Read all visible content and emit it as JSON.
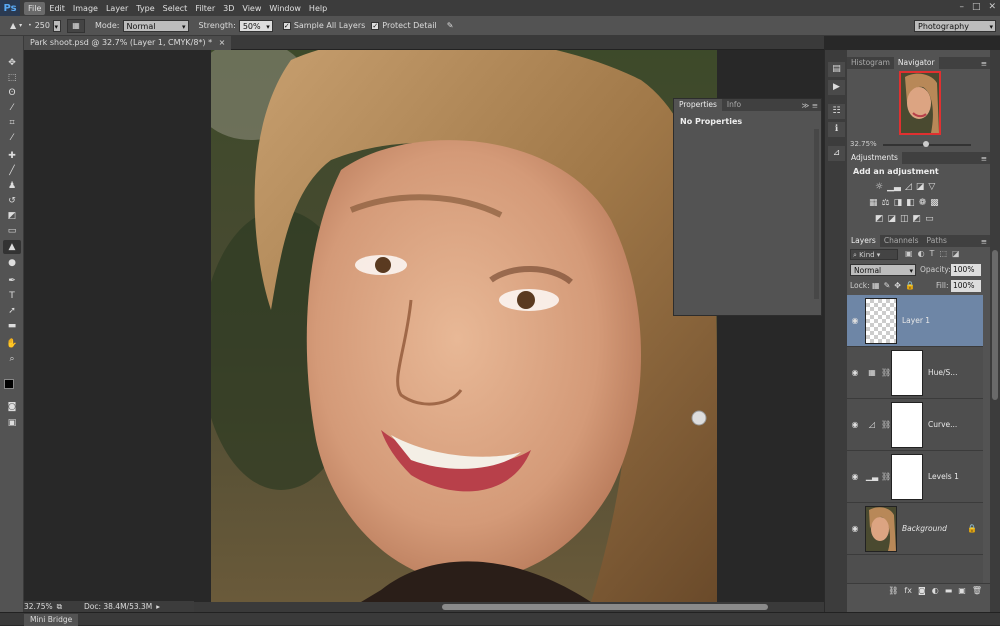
{
  "menubar": {
    "logo": "Ps",
    "items": [
      "File",
      "Edit",
      "Image",
      "Layer",
      "Type",
      "Select",
      "Filter",
      "3D",
      "View",
      "Window",
      "Help"
    ],
    "active": "File",
    "window_buttons": [
      "–",
      "□",
      "✕"
    ]
  },
  "options": {
    "brush_size": "250",
    "mode_label": "Mode:",
    "mode_value": "Normal",
    "strength_label": "Strength:",
    "strength_value": "50%",
    "sample_all_layers": "Sample All Layers",
    "protect_detail": "Protect Detail",
    "workspace": "Photography"
  },
  "document": {
    "tab_title": "Park shoot.psd @ 32.7% (Layer 1, CMYK/8*) *",
    "tab_close": "×",
    "zoom": "32.75%",
    "doc_info": "Doc: 38.4M/53.3M"
  },
  "minibridge": {
    "label": "Mini Bridge"
  },
  "properties_panel": {
    "tabs": [
      "Properties",
      "Info"
    ],
    "message": "No Properties"
  },
  "navigator_panel": {
    "tabs": [
      "Histogram",
      "Navigator"
    ],
    "zoom": "32.75%"
  },
  "adjustments_panel": {
    "title": "Adjustments",
    "subtitle": "Add an adjustment"
  },
  "layers_panel": {
    "tabs": [
      "Layers",
      "Channels",
      "Paths"
    ],
    "filter_kind": "Kind",
    "blend_mode": "Normal",
    "opacity_label": "Opacity:",
    "opacity_value": "100%",
    "lock_label": "Lock:",
    "fill_label": "Fill:",
    "fill_value": "100%",
    "layers": [
      {
        "name": "Layer 1",
        "selected": true
      },
      {
        "name": "Hue/S...",
        "selected": false
      },
      {
        "name": "Curve...",
        "selected": false
      },
      {
        "name": "Levels 1",
        "selected": false
      },
      {
        "name": "Background",
        "selected": false
      }
    ],
    "footer_icons": [
      "link-icon",
      "fx-icon",
      "mask-icon",
      "adjustment-icon",
      "folder-icon",
      "new-layer-icon",
      "trash-icon"
    ]
  },
  "colors": {
    "selected_layer": "#6e86a6",
    "panel_bg": "#535353",
    "app_bg": "#282828"
  }
}
